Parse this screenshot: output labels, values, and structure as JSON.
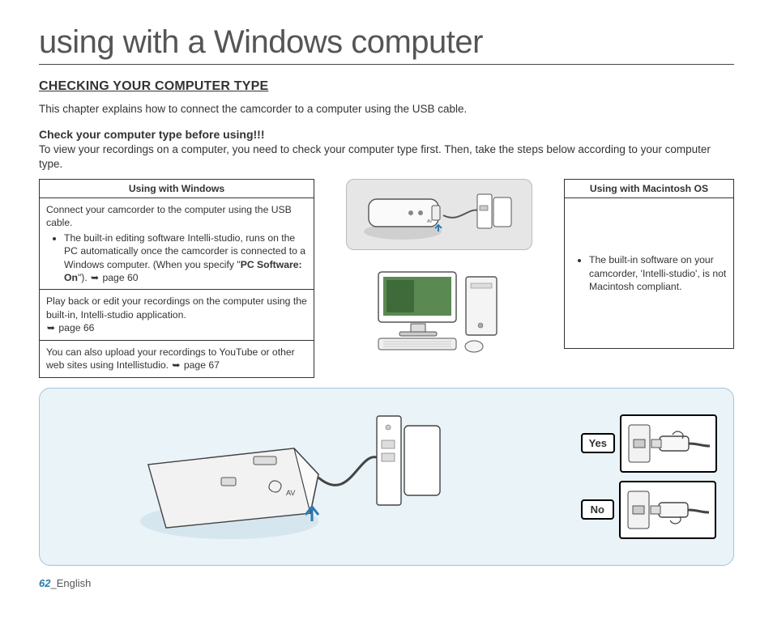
{
  "title": "using with a Windows computer",
  "section_header": "CHECKING YOUR COMPUTER TYPE",
  "intro": "This chapter explains how to connect the camcorder to a computer using the USB cable.",
  "sub_header": "Check your computer type before using!!!",
  "sub_para": "To view your recordings on a computer, you need to check your computer type first. Then, take the steps below according to your computer type.",
  "windows": {
    "header": "Using with Windows",
    "row1_lead": "Connect your camcorder to the computer using the USB cable.",
    "row1_bullet_a": "The built-in editing software Intelli-studio, runs on the PC automatically once the camcorder is connected to a Windows computer. (When you specify \"",
    "row1_bullet_bold": "PC Software: On",
    "row1_bullet_b": "\"). ",
    "row1_pageref": "page 60",
    "row2_a": "Play back or edit your recordings on the computer using the built-in, Intelli-studio application.",
    "row2_pageref": "page 66",
    "row3_a": "You can also upload your recordings to YouTube or other web sites using Intellistudio. ",
    "row3_pageref": "page 67"
  },
  "mac": {
    "header": "Using with Macintosh OS",
    "bullet": "The built-in software on your camcorder, 'Intelli-studio', is not Macintosh compliant."
  },
  "labels": {
    "yes": "Yes",
    "no": "No"
  },
  "footer": {
    "page": "62",
    "sep": "_",
    "lang": "English"
  },
  "arrow": "➥"
}
